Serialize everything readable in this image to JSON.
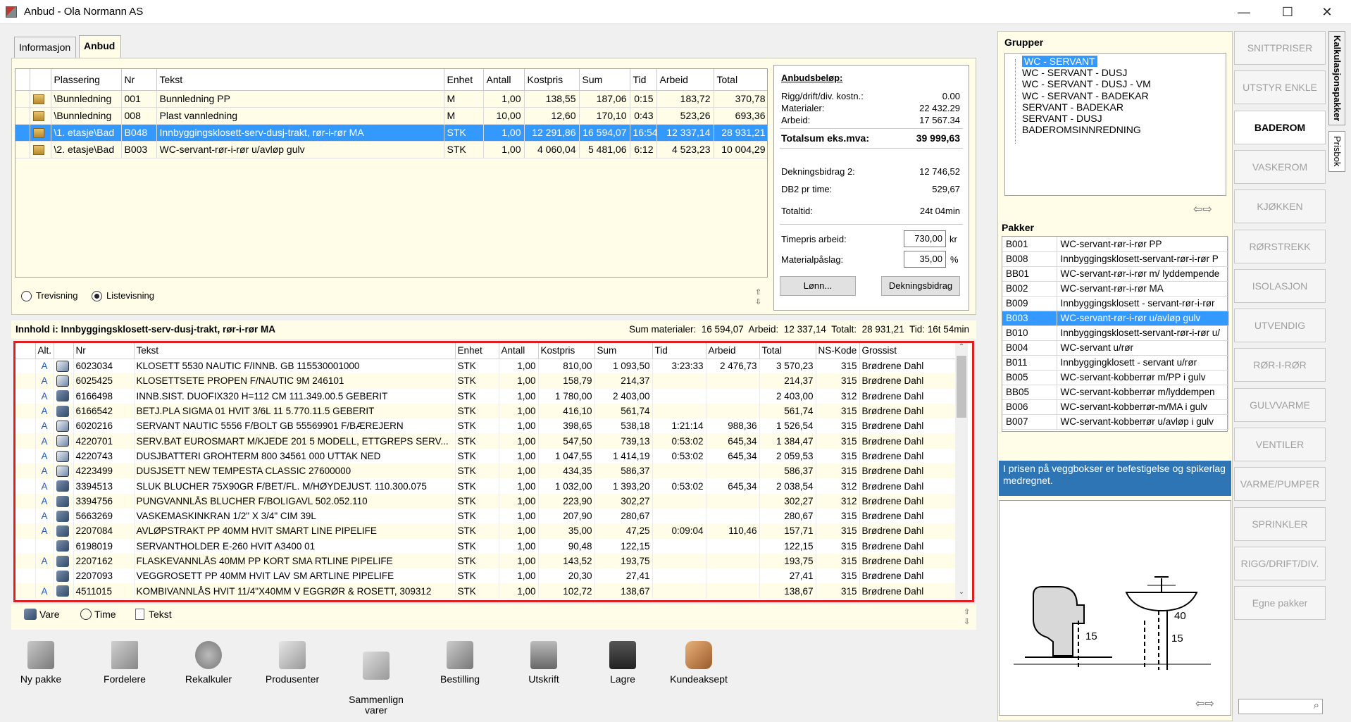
{
  "window": {
    "title": "Anbud - Ola Normann AS",
    "minimize": "—",
    "maximize": "☐",
    "close": "✕"
  },
  "tabs": [
    {
      "label": "Informasjon"
    },
    {
      "label": "Anbud"
    }
  ],
  "upper_grid": {
    "headers": [
      "",
      "Plassering",
      "Nr",
      "Tekst",
      "Enhet",
      "Antall",
      "Kostpris",
      "Sum",
      "Tid",
      "Arbeid",
      "Total"
    ],
    "rows": [
      {
        "plassering": "\\Bunnledning",
        "nr": "001",
        "tekst": "Bunnledning PP",
        "enhet": "M",
        "antall": "1,00",
        "kostpris": "138,55",
        "sum": "187,06",
        "tid": "0:15",
        "arbeid": "183,72",
        "total": "370,78"
      },
      {
        "plassering": "\\Bunnledning",
        "nr": "008",
        "tekst": "Plast vannledning",
        "enhet": "M",
        "antall": "10,00",
        "kostpris": "12,60",
        "sum": "170,10",
        "tid": "0:43",
        "arbeid": "523,26",
        "total": "693,36"
      },
      {
        "plassering": "\\1. etasje\\Bad",
        "nr": "B048",
        "tekst": "Innbyggingsklosett-serv-dusj-trakt, rør-i-rør MA",
        "enhet": "STK",
        "antall": "1,00",
        "kostpris": "12 291,86",
        "sum": "16 594,07",
        "tid": "16:54",
        "arbeid": "12 337,14",
        "total": "28 931,21"
      },
      {
        "plassering": "\\2. etasje\\Bad",
        "nr": "B003",
        "tekst": "WC-servant-rør-i-rør u/avløp gulv",
        "enhet": "STK",
        "antall": "1,00",
        "kostpris": "4 060,04",
        "sum": "5 481,06",
        "tid": "6:12",
        "arbeid": "4 523,23",
        "total": "10 004,29"
      }
    ]
  },
  "summary": {
    "heading": "Anbudsbeløp:",
    "rigg_label": "Rigg/drift/div. kostn.:",
    "rigg_value": "0.00",
    "materialer_label": "Materialer:",
    "materialer_value": "22 432.29",
    "arbeid_label": "Arbeid:",
    "arbeid_value": "17 567.34",
    "totalsum_label": "Totalsum eks.mva:",
    "totalsum_value": "39 999,63",
    "db2_label": "Dekningsbidrag 2:",
    "db2_value": "12 746,52",
    "db2_time_label": "DB2 pr time:",
    "db2_time_value": "529,67",
    "totaltid_label": "Totaltid:",
    "totaltid_value": "24t 04min",
    "timepris_label": "Timepris arbeid:",
    "timepris_value": "730,00",
    "timepris_unit": "kr",
    "materialpaslag_label": "Materialpåslag:",
    "materialpaslag_value": "35,00",
    "materialpaslag_unit": "%",
    "lonn_button": "Lønn...",
    "dekningsbidrag_button": "Dekningsbidrag"
  },
  "view_options": {
    "trevisning": "Trevisning",
    "listevisning": "Listevisning"
  },
  "innhold": {
    "title": "Innhold i: Innbyggingsklosett-serv-dusj-trakt, rør-i-rør MA",
    "totals": "Sum materialer:  16 594,07  Arbeid:  12 337,14  Totalt:  28 931,21  Tid: 16t 54min"
  },
  "lower_grid": {
    "headers": [
      "Alt.",
      "",
      "Nr",
      "Tekst",
      "Enhet",
      "Antall",
      "Kostpris",
      "Sum",
      "Tid",
      "Arbeid",
      "Total",
      "NS-Kode",
      "Grossist"
    ],
    "rows": [
      {
        "alt": "A",
        "boxed": true,
        "nr": "6023034",
        "tekst": "KLOSETT 5530 NAUTIC F/INNB. GB 115530001000",
        "enhet": "STK",
        "antall": "1,00",
        "kostpris": "810,00",
        "sum": "1 093,50",
        "tid": "3:23:33",
        "arbeid": "2 476,73",
        "total": "3 570,23",
        "ns": "315",
        "grossist": "Brødrene Dahl"
      },
      {
        "alt": "A",
        "boxed": true,
        "nr": "6025425",
        "tekst": "KLOSETTSETE PROPEN F/NAUTIC 9M 246101",
        "enhet": "STK",
        "antall": "1,00",
        "kostpris": "158,79",
        "sum": "214,37",
        "tid": "",
        "arbeid": "",
        "total": "214,37",
        "ns": "315",
        "grossist": "Brødrene Dahl"
      },
      {
        "alt": "A",
        "boxed": false,
        "nr": "6166498",
        "tekst": "INNB.SIST. DUOFIX320 H=112 CM 111.349.00.5 GEBERIT",
        "enhet": "STK",
        "antall": "1,00",
        "kostpris": "1 780,00",
        "sum": "2 403,00",
        "tid": "",
        "arbeid": "",
        "total": "2 403,00",
        "ns": "312",
        "grossist": "Brødrene Dahl"
      },
      {
        "alt": "A",
        "boxed": false,
        "nr": "6166542",
        "tekst": "BETJ.PLA SIGMA 01 HVIT 3/6L 11 5.770.11.5 GEBERIT",
        "enhet": "STK",
        "antall": "1,00",
        "kostpris": "416,10",
        "sum": "561,74",
        "tid": "",
        "arbeid": "",
        "total": "561,74",
        "ns": "315",
        "grossist": "Brødrene Dahl"
      },
      {
        "alt": "A",
        "boxed": true,
        "nr": "6020216",
        "tekst": "SERVANT NAUTIC 5556 F/BOLT GB 55569901 F/BÆREJERN",
        "enhet": "STK",
        "antall": "1,00",
        "kostpris": "398,65",
        "sum": "538,18",
        "tid": "1:21:14",
        "arbeid": "988,36",
        "total": "1 526,54",
        "ns": "315",
        "grossist": "Brødrene Dahl"
      },
      {
        "alt": "A",
        "boxed": true,
        "nr": "4220701",
        "tekst": "SERV.BAT EUROSMART M/KJEDE 201 5 MODELL, ETTGREPS SERV...",
        "enhet": "STK",
        "antall": "1,00",
        "kostpris": "547,50",
        "sum": "739,13",
        "tid": "0:53:02",
        "arbeid": "645,34",
        "total": "1 384,47",
        "ns": "315",
        "grossist": "Brødrene Dahl"
      },
      {
        "alt": "A",
        "boxed": true,
        "nr": "4220743",
        "tekst": "DUSJBATTERI GROHTERM 800 34561 000 UTTAK NED",
        "enhet": "STK",
        "antall": "1,00",
        "kostpris": "1 047,55",
        "sum": "1 414,19",
        "tid": "0:53:02",
        "arbeid": "645,34",
        "total": "2 059,53",
        "ns": "315",
        "grossist": "Brødrene Dahl"
      },
      {
        "alt": "A",
        "boxed": true,
        "nr": "4223499",
        "tekst": "DUSJSETT NEW TEMPESTA CLASSIC 27600000",
        "enhet": "STK",
        "antall": "1,00",
        "kostpris": "434,35",
        "sum": "586,37",
        "tid": "",
        "arbeid": "",
        "total": "586,37",
        "ns": "315",
        "grossist": "Brødrene Dahl"
      },
      {
        "alt": "A",
        "boxed": false,
        "nr": "3394513",
        "tekst": "SLUK BLUCHER 75X90GR F/BET/FL. M/HØYDEJUST.     110.300.075",
        "enhet": "STK",
        "antall": "1,00",
        "kostpris": "1 032,00",
        "sum": "1 393,20",
        "tid": "0:53:02",
        "arbeid": "645,34",
        "total": "2 038,54",
        "ns": "312",
        "grossist": "Brødrene Dahl"
      },
      {
        "alt": "A",
        "boxed": false,
        "nr": "3394756",
        "tekst": "PUNGVANNLÅS BLUCHER F/BOLIGAVL 502.052.110",
        "enhet": "STK",
        "antall": "1,00",
        "kostpris": "223,90",
        "sum": "302,27",
        "tid": "",
        "arbeid": "",
        "total": "302,27",
        "ns": "312",
        "grossist": "Brødrene Dahl"
      },
      {
        "alt": "A",
        "boxed": false,
        "nr": "5663269",
        "tekst": "VASKEMASKINKRAN    1/2\" X 3/4\" CIM 39L",
        "enhet": "STK",
        "antall": "1,00",
        "kostpris": "207,90",
        "sum": "280,67",
        "tid": "",
        "arbeid": "",
        "total": "280,67",
        "ns": "315",
        "grossist": "Brødrene Dahl"
      },
      {
        "alt": "A",
        "boxed": false,
        "nr": "2207084",
        "tekst": "AVLØPSTRAKT PP 40MM HVIT SMART LINE PIPELIFE",
        "enhet": "STK",
        "antall": "1,00",
        "kostpris": "35,00",
        "sum": "47,25",
        "tid": "0:09:04",
        "arbeid": "110,46",
        "total": "157,71",
        "ns": "315",
        "grossist": "Brødrene Dahl"
      },
      {
        "alt": "",
        "boxed": false,
        "nr": "6198019",
        "tekst": "SERVANTHOLDER E-260 HVIT A3400 01",
        "enhet": "STK",
        "antall": "1,00",
        "kostpris": "90,48",
        "sum": "122,15",
        "tid": "",
        "arbeid": "",
        "total": "122,15",
        "ns": "315",
        "grossist": "Brødrene Dahl"
      },
      {
        "alt": "A",
        "boxed": false,
        "nr": "2207162",
        "tekst": "FLASKEVANNLÅS 40MM PP KORT SMA RTLINE PIPELIFE",
        "enhet": "STK",
        "antall": "1,00",
        "kostpris": "143,52",
        "sum": "193,75",
        "tid": "",
        "arbeid": "",
        "total": "193,75",
        "ns": "315",
        "grossist": "Brødrene Dahl"
      },
      {
        "alt": "",
        "boxed": false,
        "nr": "2207093",
        "tekst": "VEGGROSETT PP 40MM HVIT LAV SM ARTLINE PIPELIFE",
        "enhet": "STK",
        "antall": "1,00",
        "kostpris": "20,30",
        "sum": "27,41",
        "tid": "",
        "arbeid": "",
        "total": "27,41",
        "ns": "315",
        "grossist": "Brødrene Dahl"
      },
      {
        "alt": "A",
        "boxed": false,
        "nr": "4511015",
        "tekst": "KOMBIVANNLÅS HVIT 11/4\"X40MM V EGGRØR & ROSETT, 309312",
        "enhet": "STK",
        "antall": "1,00",
        "kostpris": "102,72",
        "sum": "138,67",
        "tid": "",
        "arbeid": "",
        "total": "138,67",
        "ns": "315",
        "grossist": "Brødrene Dahl"
      }
    ]
  },
  "legend": {
    "vare": "Vare",
    "time": "Time",
    "tekst": "Tekst"
  },
  "toolbar": [
    {
      "label": "Ny pakke",
      "icon": "ny-pakke-icon"
    },
    {
      "label": "Fordelere",
      "icon": "fordelere-icon"
    },
    {
      "label": "Rekalkuler",
      "icon": "rekalkuler-icon"
    },
    {
      "label": "Produsenter",
      "icon": "produsenter-icon"
    },
    {
      "label": "Sammenlign\nvarer",
      "icon": "sammenlign-icon"
    },
    {
      "label": "Bestilling",
      "icon": "bestilling-icon"
    },
    {
      "label": "Utskrift",
      "icon": "printer-icon"
    },
    {
      "label": "Lagre",
      "icon": "save-icon"
    },
    {
      "label": "Kundeaksept",
      "icon": "handshake-icon"
    }
  ],
  "grupper": {
    "title": "Grupper",
    "items": [
      "WC - SERVANT",
      "WC - SERVANT - DUSJ",
      "WC - SERVANT - DUSJ - VM",
      "WC - SERVANT - BADEKAR",
      "SERVANT - BADEKAR",
      "SERVANT - DUSJ",
      "BADEROMSINNREDNING"
    ]
  },
  "pakker": {
    "title": "Pakker",
    "items": [
      {
        "code": "B001",
        "name": "WC-servant-rør-i-rør PP"
      },
      {
        "code": "B008",
        "name": "Innbyggingsklosett-servant-rør-i-rør P"
      },
      {
        "code": "BB01",
        "name": "WC-servant-rør-i-rør m/ lyddempende"
      },
      {
        "code": "B002",
        "name": "WC-servant-rør-i-rør MA"
      },
      {
        "code": "B009",
        "name": "Innbyggingsklosett - servant-rør-i-rør"
      },
      {
        "code": "B003",
        "name": "WC-servant-rør-i-rør u/avløp gulv"
      },
      {
        "code": "B010",
        "name": "Innbyggingsklosett-servant-rør-i-rør u/"
      },
      {
        "code": "B004",
        "name": "WC-servant u/rør"
      },
      {
        "code": "B011",
        "name": "Innbyggingklosett - servant u/rør"
      },
      {
        "code": "B005",
        "name": "WC-servant-kobberrør m/PP i gulv"
      },
      {
        "code": "BB05",
        "name": "WC-servant-kobberrør m/lyddempen"
      },
      {
        "code": "B006",
        "name": "WC-servant-kobberrør-m/MA i gulv"
      },
      {
        "code": "B007",
        "name": "WC-servant-kobberrør u/avløp i gulv"
      }
    ]
  },
  "info_text": "I prisen på veggbokser er befestigelse og spikerlag medregnet.",
  "drawing": {
    "dim1": "15",
    "dim2": "40",
    "dim3": "15"
  },
  "categories": [
    "SNITTPRISER",
    "UTSTYR  ENKLE",
    "BADEROM",
    "VASKEROM",
    "KJØKKEN",
    "RØRSTREKK",
    "ISOLASJON",
    "UTVENDIG",
    "RØR-I-RØR",
    "GULVVARME",
    "VENTILER",
    "VARME/PUMPER",
    "SPRINKLER",
    "RIGG/DRIFT/DIV.",
    "Egne pakker"
  ],
  "side_tabs": {
    "kalkulasjonspakker": "Kalkulasjonspakker",
    "prisbok": "Prisbok"
  },
  "colors": {
    "selection": "#3399ff",
    "panel_bg": "#fffde8",
    "highlight_border": "#e02020",
    "info_bg": "#2e75b6"
  }
}
